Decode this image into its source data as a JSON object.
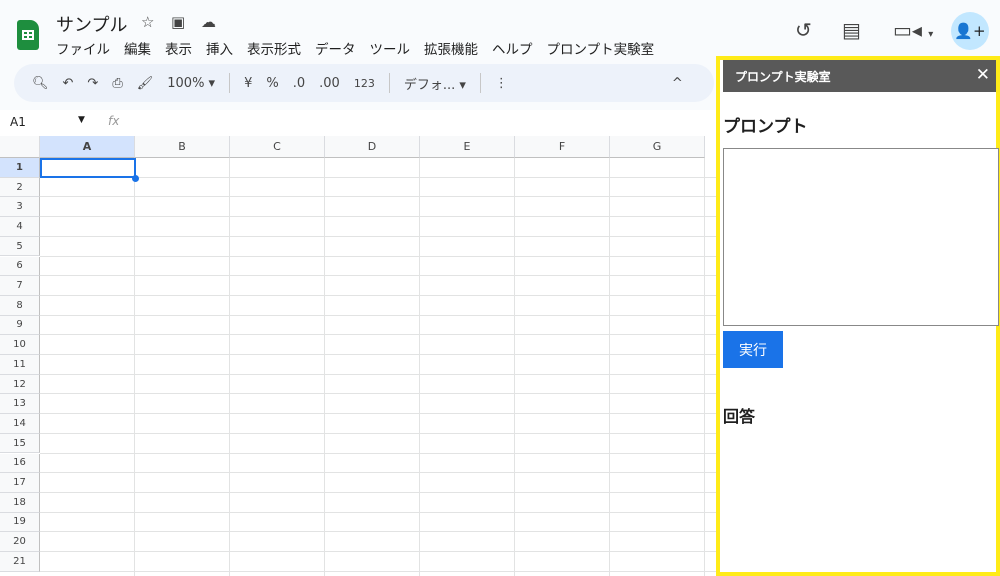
{
  "doc": {
    "title": "サンプル"
  },
  "menu": [
    "ファイル",
    "編集",
    "表示",
    "挿入",
    "表示形式",
    "データ",
    "ツール",
    "拡張機能",
    "ヘルプ",
    "プロンプト実験室"
  ],
  "toolbar": {
    "zoom": "100%",
    "currency": "¥",
    "percent": "%",
    "dec_less": ".0",
    "dec_more": ".00",
    "number_format": "123",
    "font": "デフォ..."
  },
  "formula": {
    "cell_ref": "A1",
    "fx": "fx",
    "value": ""
  },
  "columns": [
    "A",
    "B",
    "C",
    "D",
    "E",
    "F",
    "G"
  ],
  "rows": [
    "1",
    "2",
    "3",
    "4",
    "5",
    "6",
    "7",
    "8",
    "9",
    "10",
    "11",
    "12",
    "13",
    "14",
    "15",
    "16",
    "17",
    "18",
    "19",
    "20",
    "21"
  ],
  "sidebar": {
    "title": "プロンプト実験室",
    "prompt_heading": "プロンプト",
    "prompt_value": "",
    "run_label": "実行",
    "answer_heading": "回答"
  },
  "colors": {
    "highlight": "#ffeb18",
    "run": "#1a73e8",
    "sheets_green": "#1e8e3e"
  }
}
